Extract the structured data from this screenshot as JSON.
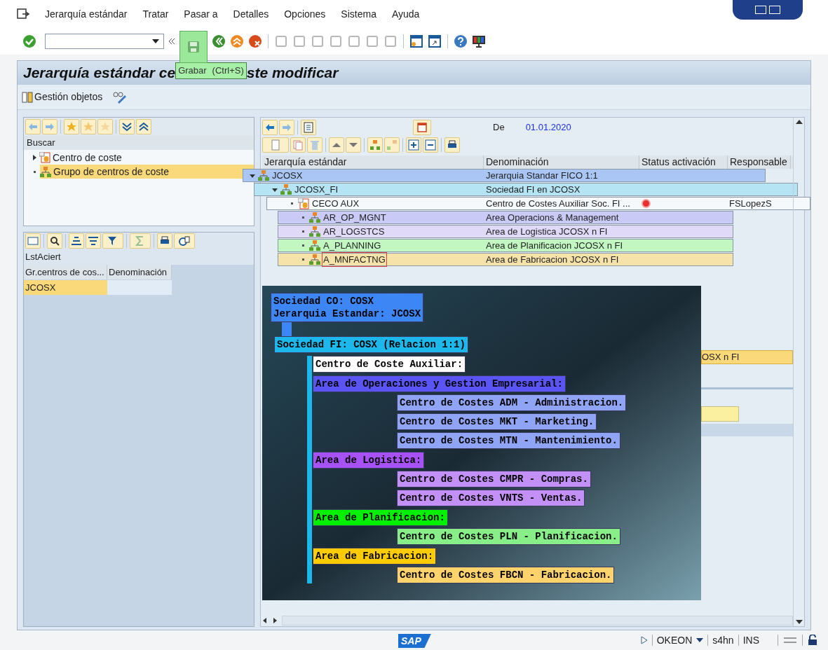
{
  "menu_bar": {
    "items": [
      "Jerarquía estándar",
      "Tratar",
      "Pasar a",
      "Detalles",
      "Opciones",
      "Sistema",
      "Ayuda"
    ]
  },
  "tooltip": {
    "label": "Grabar",
    "shortcut": "(Ctrl+S)"
  },
  "title": {
    "start": "Jerarquía estándar ce",
    "end": "ste modificar"
  },
  "app_toolbar": {
    "button": "Gestión objetos"
  },
  "search_tree": {
    "header": "Buscar",
    "items": [
      {
        "label": "Centro de coste",
        "kind": "cost_center",
        "has_children": true,
        "selected": false
      },
      {
        "label": "Grupo de centros de coste",
        "kind": "group",
        "has_children": false,
        "selected": true
      }
    ]
  },
  "results": {
    "title": "LstAciert",
    "columns": [
      "Gr.centros de cos...",
      "Denominación"
    ],
    "rows": [
      {
        "group": "JCOSX",
        "selected": true
      }
    ]
  },
  "date_filter": {
    "label": "De",
    "value": "01.01.2020"
  },
  "hierarchy": {
    "columns": [
      "Jerarquía estándar",
      "Denominación",
      "Status activación",
      "Responsable"
    ],
    "rows": [
      {
        "node": "JCOSX",
        "description": "Jerarquia Standar FICO 1:1",
        "kind": "group",
        "expanded": true,
        "selected": false,
        "color": "#a9c6f4",
        "children": [
          {
            "node": "JCOSX_FI",
            "description": "Sociedad FI en JCOSX",
            "kind": "group",
            "expanded": true,
            "selected": false,
            "color": "#b5e4f4",
            "children": [
              {
                "node": "CECO AUX",
                "description": "Centro de Costes Auxiliar Soc. FI ...",
                "kind": "cost_center",
                "expanded": false,
                "selected": false,
                "color": "#f6f9fb",
                "status_error": true,
                "responsible": "FSLopezS"
              },
              {
                "node": "AR_OP_MGNT",
                "description": "Area Operacions & Management",
                "kind": "group",
                "expanded": false,
                "selected": false,
                "color": "#cacaf6"
              },
              {
                "node": "AR_LOGSTCS",
                "description": "Area de Logistica JCOSX n FI",
                "kind": "group",
                "expanded": false,
                "selected": false,
                "color": "#e1d9f8"
              },
              {
                "node": "A_PLANNING",
                "description": "Area de Planificacion JCOSX n FI",
                "kind": "group",
                "expanded": false,
                "selected": false,
                "color": "#c2f7c2"
              },
              {
                "node": "A_MNFACTNG",
                "description": "Area de Fabricacion JCOSX n FI",
                "kind": "group",
                "expanded": false,
                "selected": true,
                "color": "#f6e3aa"
              }
            ]
          }
        ]
      }
    ]
  },
  "diagram": {
    "root": {
      "lines": [
        "Sociedad CO: COSX",
        "Jerarquia Estandar: JCOSX"
      ],
      "color": "#3d86f5",
      "children": [
        {
          "lines": [
            "Sociedad FI: COSX (Relacion 1:1)"
          ],
          "color": "#1cb8ec",
          "children": [
            {
              "lines": [
                "Centro de Coste Auxiliar:"
              ],
              "color": "#ffffff"
            },
            {
              "lines": [
                "Area de Operaciones y Gestion Empresarial:"
              ],
              "color": "#5a54f4",
              "children": [
                {
                  "lines": [
                    "Centro de Costes ADM - Administracion."
                  ],
                  "color": "#8fa4f4"
                },
                {
                  "lines": [
                    "Centro de Costes MKT - Marketing."
                  ],
                  "color": "#8fa4f4"
                },
                {
                  "lines": [
                    "Centro de Costes MTN - Mantenimiento."
                  ],
                  "color": "#8fa4f4"
                }
              ]
            },
            {
              "lines": [
                "Area de Logistica:"
              ],
              "color": "#a652f6",
              "children": [
                {
                  "lines": [
                    "Centro de Costes CMPR - Compras."
                  ],
                  "color": "#c290f6"
                },
                {
                  "lines": [
                    "Centro de Costes VNTS - Ventas."
                  ],
                  "color": "#c290f6"
                }
              ]
            },
            {
              "lines": [
                "Area de Planificacion:"
              ],
              "color": "#00f000",
              "children": [
                {
                  "lines": [
                    "Centro de Costes PLN - Planificacion."
                  ],
                  "color": "#88ef88"
                }
              ]
            },
            {
              "lines": [
                "Area de Fabricacion:"
              ],
              "color": "#ffcc00",
              "children": [
                {
                  "lines": [
                    "Centro de Costes FBCN - Fabricacion."
                  ],
                  "color": "#ffd36c"
                }
              ]
            }
          ]
        }
      ]
    }
  },
  "hidden_row_fragment": "OSX n FI",
  "status_bar": {
    "logo": "SAP",
    "client": "OKEON",
    "system": "s4hn",
    "mode": "INS"
  }
}
